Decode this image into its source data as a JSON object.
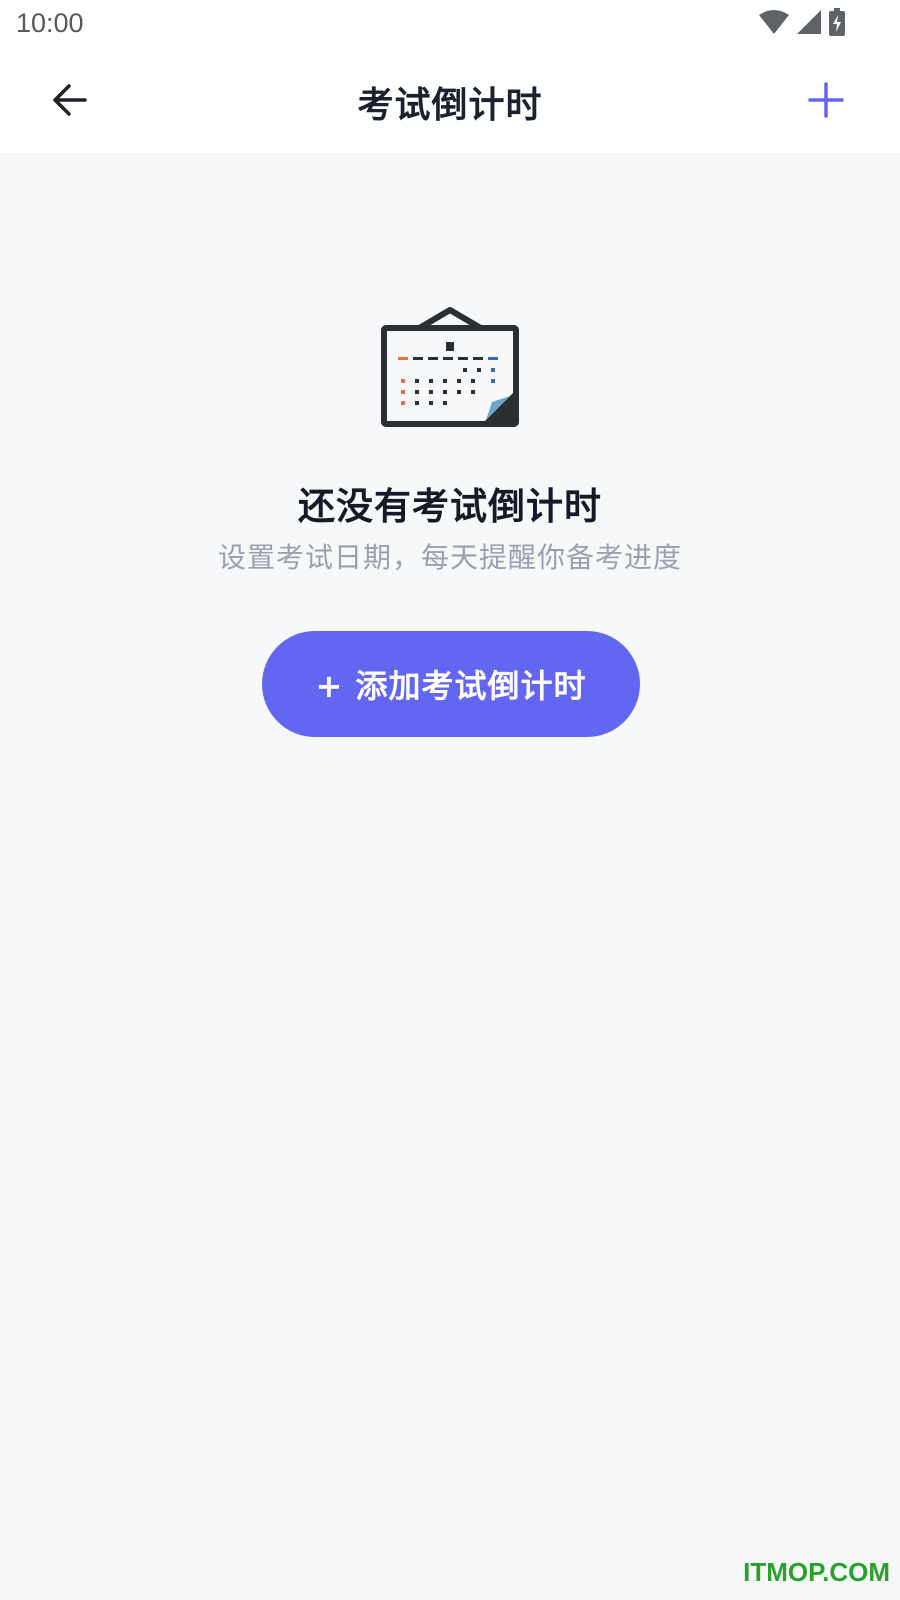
{
  "status_bar": {
    "time": "10:00",
    "icons": [
      "wifi-icon",
      "cellular-signal-icon",
      "battery-charging-icon"
    ]
  },
  "app_bar": {
    "back_icon": "arrow-left-icon",
    "title": "考试倒计时",
    "add_icon": "plus-icon"
  },
  "empty_state": {
    "illustration": "calendar-icon",
    "title": "还没有考试倒计时",
    "subtitle": "设置考试日期，每天提醒你备考进度",
    "button_label": "+ 添加考试倒计时"
  },
  "watermark": "ITMOP.COM",
  "colors": {
    "accent": "#6366f1",
    "background": "#f7f8fa",
    "title_text": "#1c2130",
    "subtitle_text": "#9aa1ae",
    "calendar_orange": "#e8703a",
    "calendar_blue": "#2f6fb0",
    "watermark": "#2aa12a"
  }
}
